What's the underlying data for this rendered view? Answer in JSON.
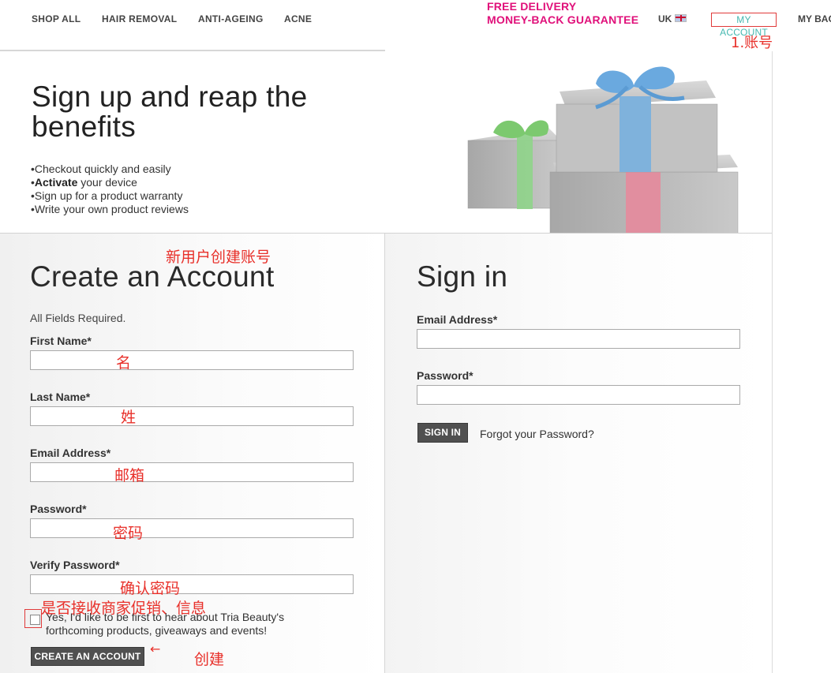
{
  "nav": {
    "items": [
      "SHOP ALL",
      "HAIR REMOVAL",
      "ANTI-AGEING",
      "ACNE"
    ],
    "promo_line1": "FREE DELIVERY",
    "promo_line2": "MONEY-BACK GUARANTEE",
    "locale": "UK",
    "my_account": "MY ACCOUNT",
    "my_bag": "MY BAG"
  },
  "hero": {
    "title": "Sign up and reap the benefits",
    "benefits": [
      {
        "prefix": "",
        "bold": "",
        "text": "Checkout quickly and easily"
      },
      {
        "prefix": "",
        "bold": "Activate",
        "text": " your device"
      },
      {
        "prefix": "",
        "bold": "",
        "text": "Sign up for a product warranty"
      },
      {
        "prefix": "",
        "bold": "",
        "text": "Write your own product reviews"
      }
    ]
  },
  "create_account": {
    "title": "Create an Account",
    "note": "All Fields Required.",
    "fields": [
      {
        "label": "First Name*",
        "value": ""
      },
      {
        "label": "Last Name*",
        "value": ""
      },
      {
        "label": "Email Address*",
        "value": ""
      },
      {
        "label": "Password*",
        "value": ""
      },
      {
        "label": "Verify Password*",
        "value": ""
      }
    ],
    "optin_text": "Yes, I'd like to be first to hear about Tria Beauty's forthcoming products, giveaways and events!",
    "optin_checked": false,
    "submit_label": "CREATE AN ACCOUNT"
  },
  "sign_in": {
    "title": "Sign in",
    "email_label": "Email Address*",
    "email_value": "",
    "password_label": "Password*",
    "password_value": "",
    "submit_label": "SIGN IN",
    "forgot_label": "Forgot your Password?"
  },
  "annotations": {
    "account": "1.账号",
    "new_user": "新用户创建账号",
    "first_name": "名",
    "last_name": "姓",
    "email": "邮箱",
    "password": "密码",
    "verify_password": "确认密码",
    "optin": "是否接收商家促销、信息",
    "create": "创建",
    "arrow": "←"
  },
  "colors": {
    "promo": "#e0107a",
    "account_link": "#46b8b0",
    "annotation": "#e8302a",
    "button": "#505050"
  },
  "icons": [
    "uk-flag-icon",
    "red-arrow-icon"
  ]
}
